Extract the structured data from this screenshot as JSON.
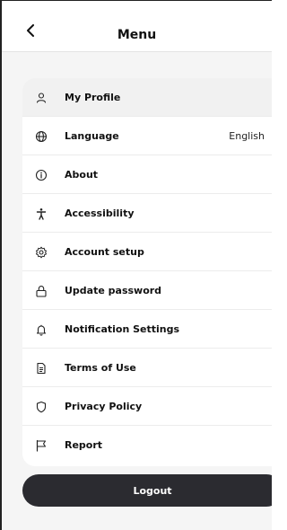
{
  "header": {
    "title": "Menu",
    "back_icon": "chevron-left-icon"
  },
  "menu": {
    "items": [
      {
        "label": "My Profile",
        "icon": "person-icon"
      },
      {
        "label": "Language",
        "icon": "globe-icon",
        "value": "English"
      },
      {
        "label": "About",
        "icon": "info-icon"
      },
      {
        "label": "Accessibility",
        "icon": "accessibility-icon"
      },
      {
        "label": "Account setup",
        "icon": "gear-icon"
      },
      {
        "label": "Update password",
        "icon": "lock-icon"
      },
      {
        "label": "Notification Settings",
        "icon": "bell-icon"
      },
      {
        "label": "Terms of Use",
        "icon": "document-icon"
      },
      {
        "label": "Privacy Policy",
        "icon": "shield-icon"
      },
      {
        "label": "Report",
        "icon": "flag-icon"
      }
    ]
  },
  "logout": {
    "label": "Logout"
  },
  "colors": {
    "background": "#f5f5f5",
    "card": "#ffffff",
    "button": "#2b2b30",
    "text": "#111111"
  }
}
